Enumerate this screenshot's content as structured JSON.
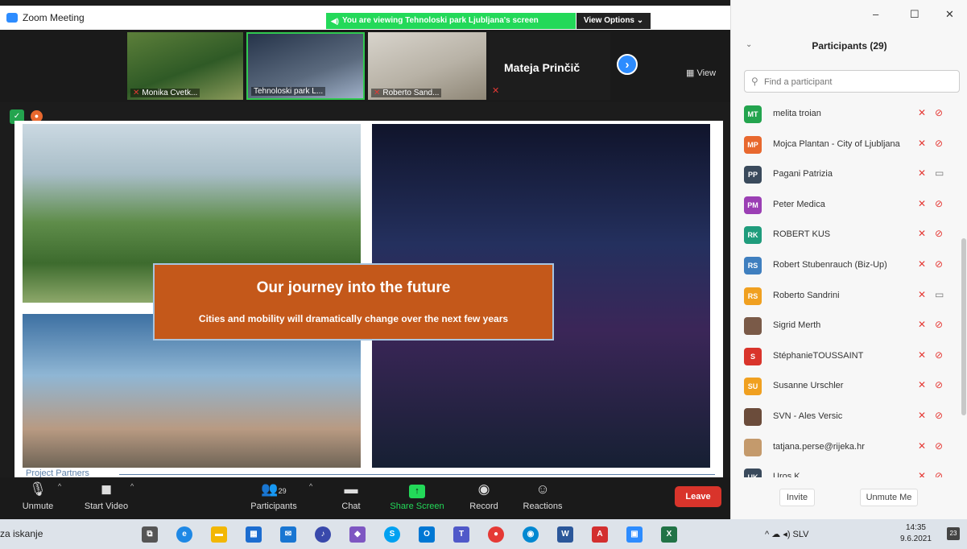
{
  "window": {
    "title": "Zoom Meeting"
  },
  "banner": {
    "text": "You are viewing Tehnoloski park Ljubljana's screen",
    "view_options": "View Options ⌄"
  },
  "thumbnails": [
    {
      "name": "Monika Cvetk..."
    },
    {
      "name": "Tehnoloski park L..."
    },
    {
      "name": "Roberto Sand..."
    },
    {
      "name": "Mateja Prinčič"
    }
  ],
  "view_label": "View",
  "slide": {
    "title": "Our journey into the future",
    "subtitle": "Cities and mobility will dramatically change over the next few years",
    "footer": "Project Partners"
  },
  "toolbar": {
    "unmute": "Unmute",
    "start_video": "Start Video",
    "participants": "Participants",
    "participants_count": "29",
    "chat": "Chat",
    "share_screen": "Share Screen",
    "record": "Record",
    "reactions": "Reactions",
    "leave": "Leave"
  },
  "panel": {
    "title": "Participants (29)",
    "search_placeholder": "Find a participant",
    "invite": "Invite",
    "unmute_me": "Unmute Me",
    "participants": [
      {
        "initials": "MT",
        "name": "melita troian",
        "color": "#23a44e",
        "video": "off"
      },
      {
        "initials": "MP",
        "name": "Mojca Plantan - City of Ljubljana",
        "color": "#e8682e",
        "video": "off"
      },
      {
        "initials": "PP",
        "name": "Pagani Patrizia",
        "color": "#3a4a5c",
        "video": "on"
      },
      {
        "initials": "PM",
        "name": "Peter Medica",
        "color": "#9b3fb4",
        "video": "off"
      },
      {
        "initials": "RK",
        "name": "ROBERT KUS",
        "color": "#1f9c7c",
        "video": "off"
      },
      {
        "initials": "RS",
        "name": "Robert Stubenrauch (Biz-Up)",
        "color": "#3f7fbf",
        "video": "off"
      },
      {
        "initials": "RS",
        "name": "Roberto Sandrini",
        "color": "#f0a020",
        "video": "on"
      },
      {
        "initials": "",
        "name": "Sigrid Merth",
        "color": "#7a5a48",
        "video": "off"
      },
      {
        "initials": "S",
        "name": "StéphanieTOUSSAINT",
        "color": "#d9342b",
        "video": "off"
      },
      {
        "initials": "SU",
        "name": "Susanne Urschler",
        "color": "#f0a020",
        "video": "off"
      },
      {
        "initials": "",
        "name": "SVN - Ales Versic",
        "color": "#6b4c3b",
        "video": "off"
      },
      {
        "initials": "",
        "name": "tatjana.perse@rijeka.hr",
        "color": "#c49a6c",
        "video": "off"
      },
      {
        "initials": "UK",
        "name": "Uros K",
        "color": "#3a4a5c",
        "video": "off"
      }
    ]
  },
  "taskbar": {
    "search_text": "za iskanje",
    "language": "SLV",
    "time": "14:35",
    "date": "9.6.2021",
    "notifications": "23"
  }
}
